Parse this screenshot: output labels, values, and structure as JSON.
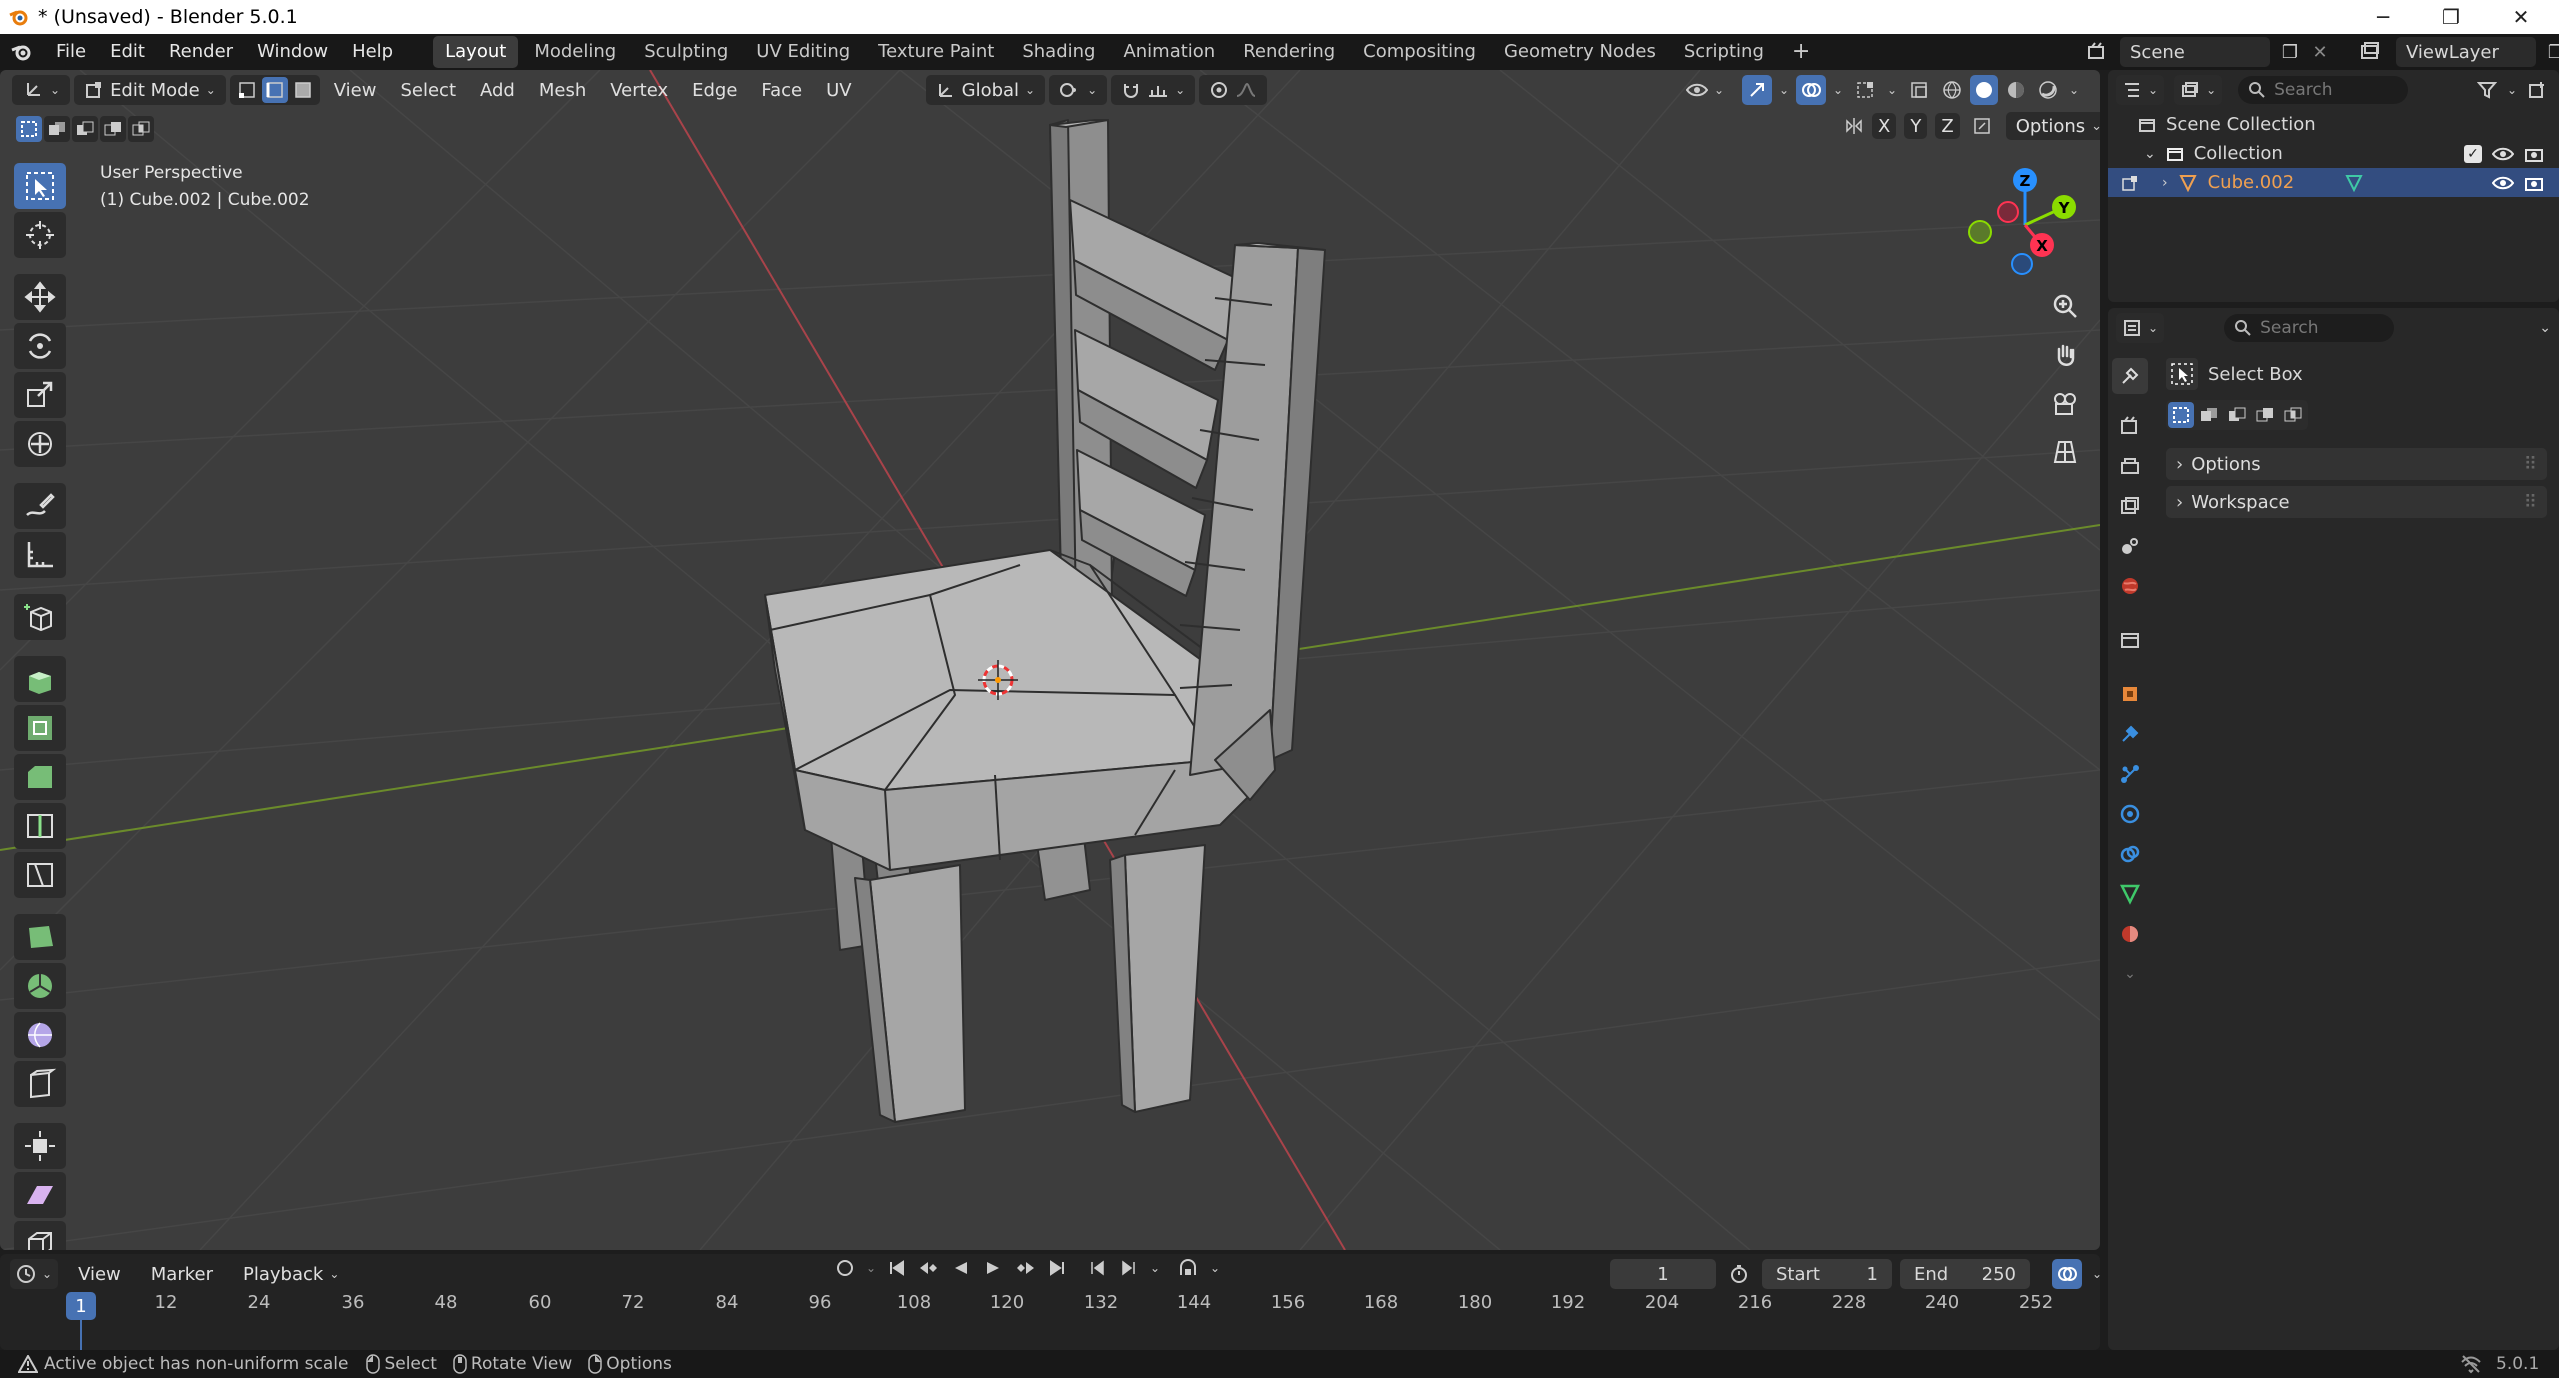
{
  "window": {
    "title": "* (Unsaved) - Blender 5.0.1"
  },
  "menu": {
    "items": [
      "File",
      "Edit",
      "Render",
      "Window",
      "Help"
    ]
  },
  "workspaces": {
    "tabs": [
      "Layout",
      "Modeling",
      "Sculpting",
      "UV Editing",
      "Texture Paint",
      "Shading",
      "Animation",
      "Rendering",
      "Compositing",
      "Geometry Nodes",
      "Scripting"
    ],
    "active": "Layout"
  },
  "scene": {
    "name": "Scene",
    "view_layer": "ViewLayer"
  },
  "viewport_header": {
    "mode": "Edit Mode",
    "menus": [
      "View",
      "Select",
      "Add",
      "Mesh",
      "Vertex",
      "Edge",
      "Face",
      "UV"
    ],
    "orientation": "Global",
    "options_label": "Options",
    "axes": [
      "X",
      "Y",
      "Z"
    ]
  },
  "viewport": {
    "view_name": "User Perspective",
    "object_info": "(1) Cube.002 | Cube.002",
    "gizmo": {
      "z": "Z",
      "y": "Y",
      "x": "X"
    }
  },
  "outliner": {
    "search_placeholder": "Search",
    "scene_collection": "Scene Collection",
    "collection": "Collection",
    "object": "Cube.002"
  },
  "properties": {
    "search_placeholder": "Search",
    "tool_name": "Select Box",
    "panels": [
      "Options",
      "Workspace"
    ]
  },
  "timeline": {
    "menus": [
      "View",
      "Marker",
      "Playback"
    ],
    "current_frame": "1",
    "start_label": "Start",
    "start_value": "1",
    "end_label": "End",
    "end_value": "250",
    "ticks": [
      "1",
      "12",
      "24",
      "36",
      "48",
      "60",
      "72",
      "84",
      "96",
      "108",
      "120",
      "132",
      "144",
      "156",
      "168",
      "180",
      "192",
      "204",
      "216",
      "228",
      "240",
      "252"
    ]
  },
  "statusbar": {
    "warning": "Active object has non-uniform scale",
    "hints": [
      "Select",
      "Rotate View",
      "Options"
    ],
    "version": "5.0.1"
  },
  "colors": {
    "accent": "#4772b3",
    "x_axis": "#ff3352",
    "y_axis": "#8bdc00",
    "z_axis": "#2890ff",
    "object_orange": "#f0a050"
  }
}
